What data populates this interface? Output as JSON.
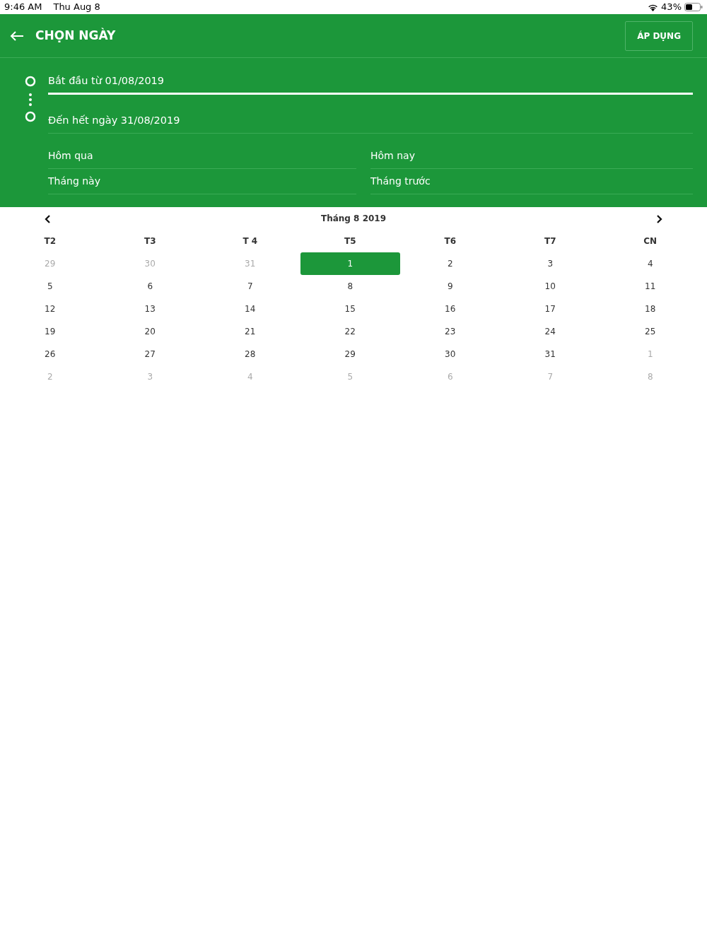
{
  "status_bar": {
    "time": "9:46 AM",
    "date": "Thu Aug 8",
    "battery": "43%"
  },
  "header": {
    "title": "CHỌN NGÀY",
    "apply_button": "ÁP DỤNG"
  },
  "range_fields": [
    {
      "value": "Bắt đầu từ 01/08/2019",
      "focused": true
    },
    {
      "value": "Đến hết ngày 31/08/2019",
      "focused": false
    }
  ],
  "shortcuts": [
    "Hôm qua",
    "Hôm nay",
    "Tháng này",
    "Tháng trước"
  ],
  "calendar": {
    "month_label": "Tháng 8 2019",
    "weekdays": [
      "T2",
      "T3",
      "T 4",
      "T5",
      "T6",
      "T7",
      "CN"
    ],
    "days": [
      {
        "label": "29",
        "muted": true,
        "selected": false
      },
      {
        "label": "30",
        "muted": true,
        "selected": false
      },
      {
        "label": "31",
        "muted": true,
        "selected": false
      },
      {
        "label": "1",
        "muted": false,
        "selected": true
      },
      {
        "label": "2",
        "muted": false,
        "selected": false
      },
      {
        "label": "3",
        "muted": false,
        "selected": false
      },
      {
        "label": "4",
        "muted": false,
        "selected": false
      },
      {
        "label": "5",
        "muted": false,
        "selected": false
      },
      {
        "label": "6",
        "muted": false,
        "selected": false
      },
      {
        "label": "7",
        "muted": false,
        "selected": false
      },
      {
        "label": "8",
        "muted": false,
        "selected": false
      },
      {
        "label": "9",
        "muted": false,
        "selected": false
      },
      {
        "label": "10",
        "muted": false,
        "selected": false
      },
      {
        "label": "11",
        "muted": false,
        "selected": false
      },
      {
        "label": "12",
        "muted": false,
        "selected": false
      },
      {
        "label": "13",
        "muted": false,
        "selected": false
      },
      {
        "label": "14",
        "muted": false,
        "selected": false
      },
      {
        "label": "15",
        "muted": false,
        "selected": false
      },
      {
        "label": "16",
        "muted": false,
        "selected": false
      },
      {
        "label": "17",
        "muted": false,
        "selected": false
      },
      {
        "label": "18",
        "muted": false,
        "selected": false
      },
      {
        "label": "19",
        "muted": false,
        "selected": false
      },
      {
        "label": "20",
        "muted": false,
        "selected": false
      },
      {
        "label": "21",
        "muted": false,
        "selected": false
      },
      {
        "label": "22",
        "muted": false,
        "selected": false
      },
      {
        "label": "23",
        "muted": false,
        "selected": false
      },
      {
        "label": "24",
        "muted": false,
        "selected": false
      },
      {
        "label": "25",
        "muted": false,
        "selected": false
      },
      {
        "label": "26",
        "muted": false,
        "selected": false
      },
      {
        "label": "27",
        "muted": false,
        "selected": false
      },
      {
        "label": "28",
        "muted": false,
        "selected": false
      },
      {
        "label": "29",
        "muted": false,
        "selected": false
      },
      {
        "label": "30",
        "muted": false,
        "selected": false
      },
      {
        "label": "31",
        "muted": false,
        "selected": false
      },
      {
        "label": "1",
        "muted": true,
        "selected": false
      },
      {
        "label": "2",
        "muted": true,
        "selected": false
      },
      {
        "label": "3",
        "muted": true,
        "selected": false
      },
      {
        "label": "4",
        "muted": true,
        "selected": false
      },
      {
        "label": "5",
        "muted": true,
        "selected": false
      },
      {
        "label": "6",
        "muted": true,
        "selected": false
      },
      {
        "label": "7",
        "muted": true,
        "selected": false
      },
      {
        "label": "8",
        "muted": true,
        "selected": false
      }
    ]
  }
}
